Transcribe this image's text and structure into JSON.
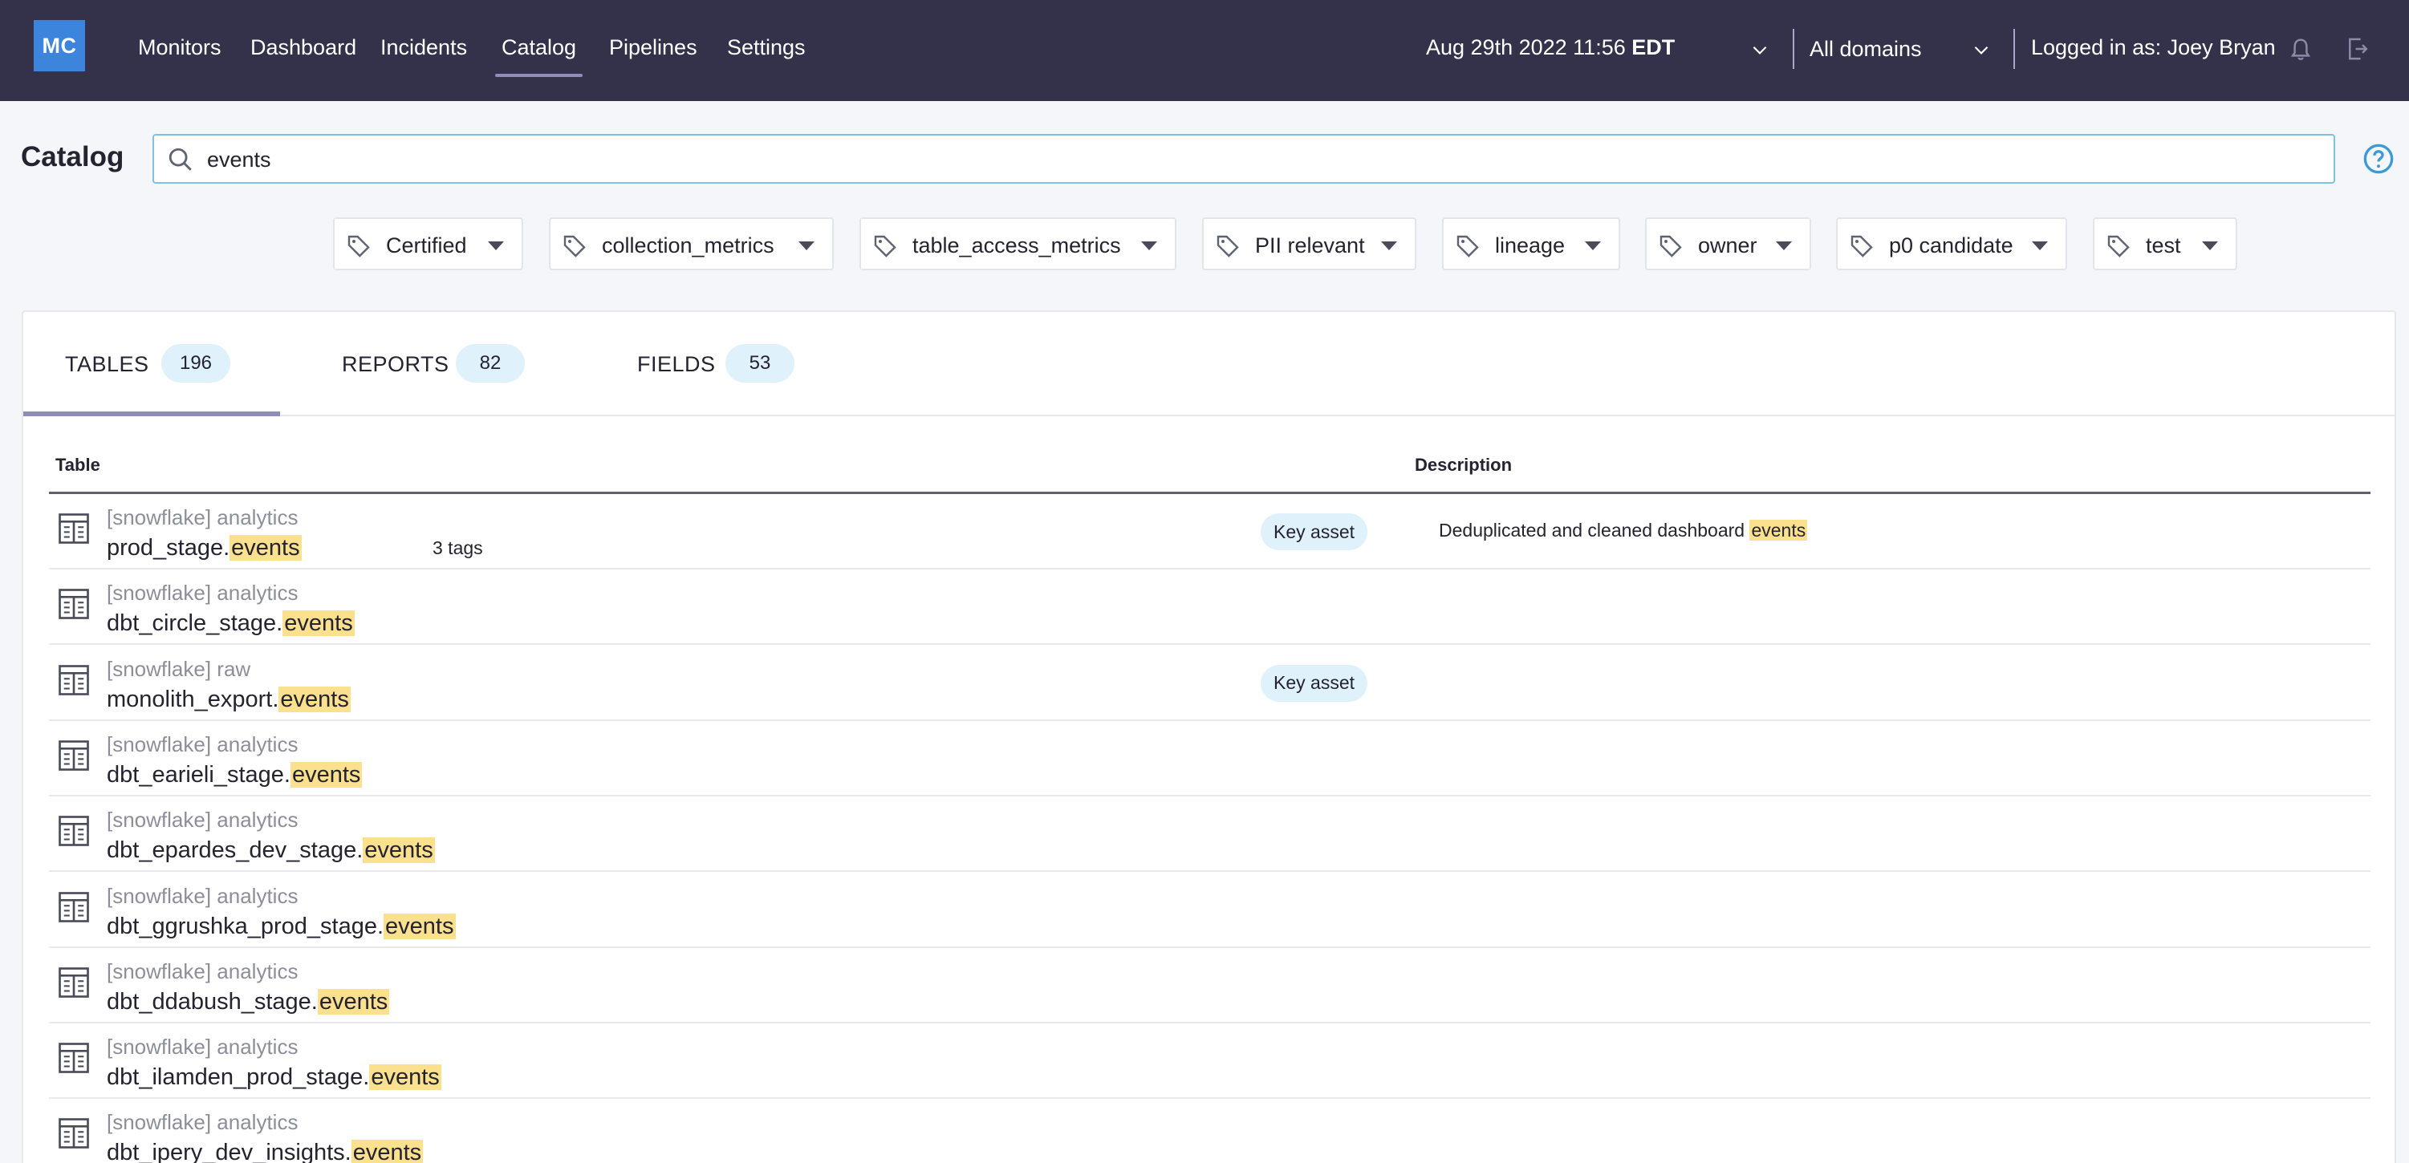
{
  "app": {
    "logo": "MC",
    "nav": [
      "Monitors",
      "Dashboard",
      "Incidents",
      "Catalog",
      "Pipelines",
      "Settings"
    ],
    "active_nav": "Catalog",
    "datetime": "Aug 29th 2022 11:56",
    "timezone": "EDT",
    "domain_select": "All domains",
    "logged_in": "Logged in as: Joey Bryan"
  },
  "catalog": {
    "title": "Catalog",
    "search_value": "events",
    "tags": [
      "Certified",
      "collection_metrics",
      "table_access_metrics",
      "PII relevant",
      "lineage",
      "owner",
      "p0 candidate",
      "test"
    ]
  },
  "tabs": [
    {
      "label": "TABLES",
      "count": "196"
    },
    {
      "label": "REPORTS",
      "count": "82"
    },
    {
      "label": "FIELDS",
      "count": "53"
    }
  ],
  "active_tab": "TABLES",
  "table": {
    "columns": {
      "table": "Table",
      "description": "Description"
    },
    "highlight": "events",
    "rows": [
      {
        "db": "[snowflake] analytics",
        "name": "prod_stage.",
        "match": "events",
        "tags": "3 tags",
        "badge": "Key asset",
        "desc": "Deduplicated and cleaned dashboard ",
        "desc_match": "events"
      },
      {
        "db": "[snowflake] analytics",
        "name": "dbt_circle_stage.",
        "match": "events",
        "tags": "",
        "badge": "",
        "desc": "",
        "desc_match": ""
      },
      {
        "db": "[snowflake] raw",
        "name": "monolith_export.",
        "match": "events",
        "tags": "",
        "badge": "Key asset",
        "desc": "",
        "desc_match": ""
      },
      {
        "db": "[snowflake] analytics",
        "name": "dbt_earieli_stage.",
        "match": "events",
        "tags": "",
        "badge": "",
        "desc": "",
        "desc_match": ""
      },
      {
        "db": "[snowflake] analytics",
        "name": "dbt_epardes_dev_stage.",
        "match": "events",
        "tags": "",
        "badge": "",
        "desc": "",
        "desc_match": ""
      },
      {
        "db": "[snowflake] analytics",
        "name": "dbt_ggrushka_prod_stage.",
        "match": "events",
        "tags": "",
        "badge": "",
        "desc": "",
        "desc_match": ""
      },
      {
        "db": "[snowflake] analytics",
        "name": "dbt_ddabush_stage.",
        "match": "events",
        "tags": "",
        "badge": "",
        "desc": "",
        "desc_match": ""
      },
      {
        "db": "[snowflake] analytics",
        "name": "dbt_ilamden_prod_stage.",
        "match": "events",
        "tags": "",
        "badge": "",
        "desc": "",
        "desc_match": ""
      },
      {
        "db": "[snowflake] analytics",
        "name": "dbt_ipery_dev_insights.",
        "match": "events",
        "tags": "",
        "badge": "",
        "desc": "",
        "desc_match": ""
      }
    ]
  }
}
